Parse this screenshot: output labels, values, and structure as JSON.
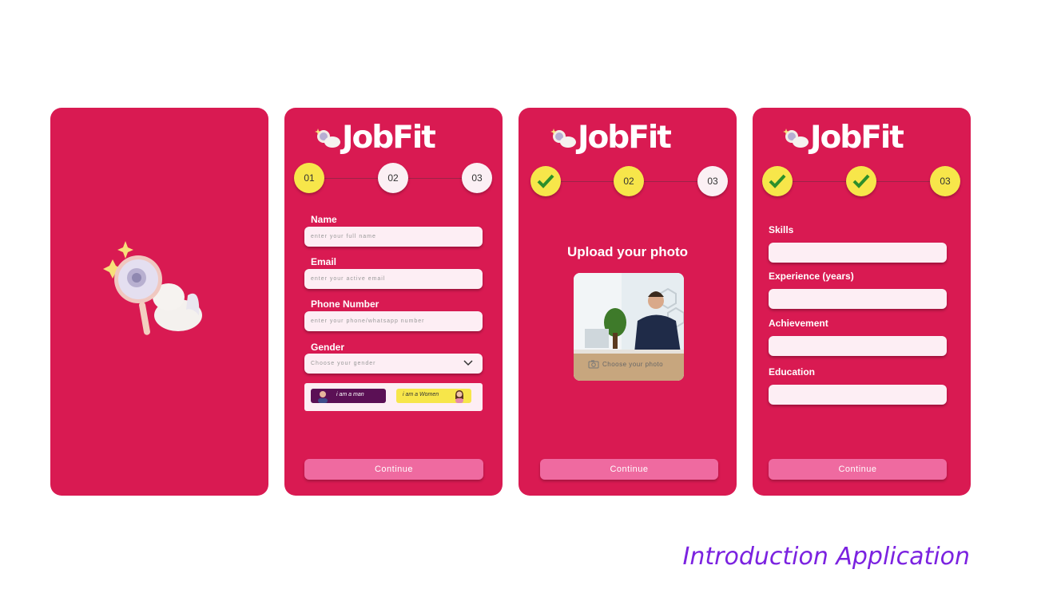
{
  "brand": {
    "logo_text": "JobFit"
  },
  "colors": {
    "screen_bg": "#d91a52",
    "step_active": "#f7e64a",
    "step_inactive": "#fbf0f4",
    "continue_bg": "#ef6aa0",
    "footer_title": "#7b22e0"
  },
  "form_screen": {
    "steps": [
      "01",
      "02",
      "03"
    ],
    "fields": [
      {
        "label": "Name",
        "placeholder": "enter your full name"
      },
      {
        "label": "Email",
        "placeholder": "enter your active email"
      },
      {
        "label": "Phone Number",
        "placeholder": "enter your phone/whatsapp number"
      }
    ],
    "gender": {
      "label": "Gender",
      "placeholder": "Choose your gender",
      "options": [
        "i am a man",
        "i am a Women"
      ]
    },
    "continue_label": "Continue"
  },
  "photo_screen": {
    "steps": [
      "",
      "02",
      "03"
    ],
    "title": "Upload your photo",
    "choose_photo_label": "Choose your photo",
    "continue_label": "Continue"
  },
  "profile_screen": {
    "steps": [
      "",
      "",
      "03"
    ],
    "fields": [
      {
        "label": "Skills"
      },
      {
        "label": "Experience (years)"
      },
      {
        "label": "Achievement"
      },
      {
        "label": "Education"
      }
    ],
    "continue_label": "Continue"
  },
  "footer": {
    "title": "Introduction Application"
  }
}
